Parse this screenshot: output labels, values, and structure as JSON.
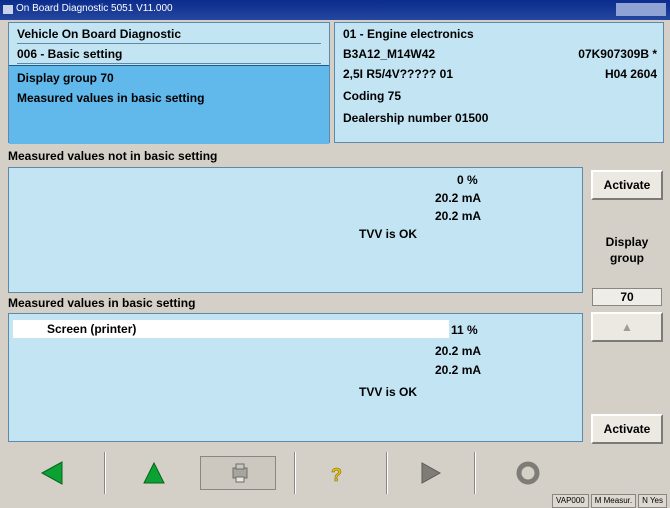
{
  "window": {
    "title": "On Board Diagnostic 5051 V11.000"
  },
  "top_left": {
    "line1": "Vehicle On Board Diagnostic",
    "line2": "006 - Basic setting",
    "line3": "Display group 70",
    "line4": "Measured values in basic setting"
  },
  "top_right": {
    "system": "01 - Engine electronics",
    "part_code": "B3A12_M14W42",
    "part_number": "07K907309B *",
    "engine": "2,5I R5/4V????? 01",
    "hw_version": "H04 2604",
    "coding": "Coding 75",
    "dealership": "Dealership number 01500"
  },
  "section1": {
    "header": "Measured values not in basic setting",
    "values": [
      "0 %",
      "20.2 mA",
      "20.2 mA",
      "TVV is OK"
    ]
  },
  "section2": {
    "header": "Measured values in basic setting",
    "values": [
      "11 %",
      "20.2 mA",
      "20.2 mA",
      "TVV is OK"
    ]
  },
  "popup": {
    "label": "Screen (printer)"
  },
  "side": {
    "activate_top": "Activate",
    "display_group_label": "Display group",
    "group_number": "70",
    "up_arrow": "▲",
    "activate_bottom": "Activate"
  },
  "toolbar": {
    "back_icon": "left-arrow-icon",
    "up_icon": "up-arrow-icon",
    "print_icon": "printer-icon",
    "help_icon": "help-icon",
    "forward_icon": "right-arrow-icon",
    "refresh_icon": "refresh-icon"
  },
  "status": {
    "field1": "VAP000",
    "field2": "M Measur.",
    "field3": "N Yes"
  },
  "colors": {
    "panel_bg": "#c3e4f3",
    "selection": "#61b8ea",
    "arrow_green": "#0ca233",
    "help_yellow": "#e3c10c"
  }
}
